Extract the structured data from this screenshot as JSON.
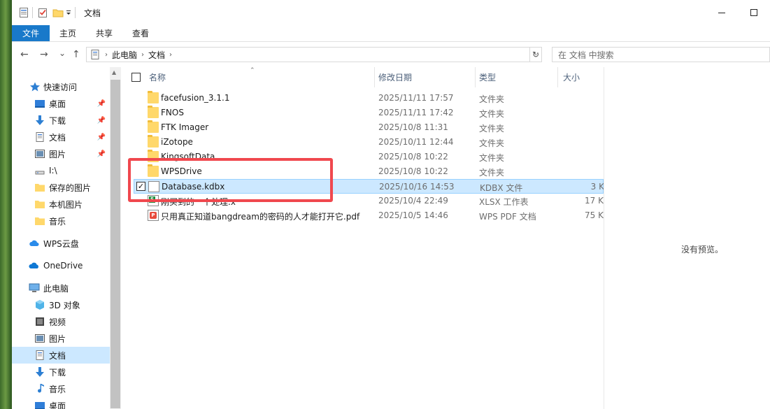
{
  "window": {
    "title": "文档",
    "controls": {
      "minimize": "—",
      "maximize": "☐"
    }
  },
  "ribbon": {
    "tabs": [
      {
        "label": "文件",
        "active": true
      },
      {
        "label": "主页",
        "active": false
      },
      {
        "label": "共享",
        "active": false
      },
      {
        "label": "查看",
        "active": false
      }
    ]
  },
  "address": {
    "back": "←",
    "forward": "→",
    "recent": "⌄",
    "up": "↑",
    "crumbs": [
      "此电脑",
      "文档"
    ],
    "refresh": "↻",
    "search_placeholder": "在 文档 中搜索"
  },
  "nav": {
    "quick_access": "快速访问",
    "items": [
      {
        "label": "桌面",
        "pinned": true
      },
      {
        "label": "下载",
        "pinned": true
      },
      {
        "label": "文档",
        "pinned": true
      },
      {
        "label": "图片",
        "pinned": true
      },
      {
        "label": "I:\\",
        "pinned": false
      },
      {
        "label": "保存的图片",
        "pinned": false
      },
      {
        "label": "本机图片",
        "pinned": false
      },
      {
        "label": "音乐",
        "pinned": false
      }
    ],
    "wps_cloud": "WPS云盘",
    "onedrive": "OneDrive",
    "this_pc": "此电脑",
    "pc_items": [
      {
        "label": "3D 对象"
      },
      {
        "label": "视频"
      },
      {
        "label": "图片"
      },
      {
        "label": "文档",
        "selected": true
      },
      {
        "label": "下载"
      },
      {
        "label": "音乐"
      },
      {
        "label": "桌面"
      }
    ]
  },
  "columns": {
    "name": "名称",
    "modified": "修改日期",
    "type": "类型",
    "size": "大小"
  },
  "files": [
    {
      "name": "facefusion_3.1.1",
      "date": "2025/11/11 17:57",
      "type": "文件夹",
      "size": "",
      "kind": "folder"
    },
    {
      "name": "FNOS",
      "date": "2025/11/11 17:42",
      "type": "文件夹",
      "size": "",
      "kind": "folder"
    },
    {
      "name": "FTK Imager",
      "date": "2025/10/8 11:31",
      "type": "文件夹",
      "size": "",
      "kind": "folder"
    },
    {
      "name": "iZotope",
      "date": "2025/10/11 12:44",
      "type": "文件夹",
      "size": "",
      "kind": "folder"
    },
    {
      "name": "KingsoftData",
      "date": "2025/10/8 10:22",
      "type": "文件夹",
      "size": "",
      "kind": "folder"
    },
    {
      "name": "WPSDrive",
      "date": "2025/10/8 10:22",
      "type": "文件夹",
      "size": "",
      "kind": "folder"
    },
    {
      "name": "Database.kdbx",
      "date": "2025/10/16 14:53",
      "type": "KDBX 文件",
      "size": "3 K",
      "kind": "file",
      "selected": true
    },
    {
      "name": "刚买到的一个处理.x",
      "date": "2025/10/4 22:49",
      "type": "XLSX 工作表",
      "size": "17 K",
      "kind": "xlsx"
    },
    {
      "name": "只用真正知道bangdream的密码的人才能打开它.pdf",
      "date": "2025/10/5 14:46",
      "type": "WPS PDF 文档",
      "size": "75 K",
      "kind": "pdf"
    }
  ],
  "preview": {
    "message": "没有预览。"
  },
  "colors": {
    "accent": "#1979ca",
    "selection": "#cce8ff",
    "highlight": "#f0484e",
    "folder": "#ffd86b"
  }
}
